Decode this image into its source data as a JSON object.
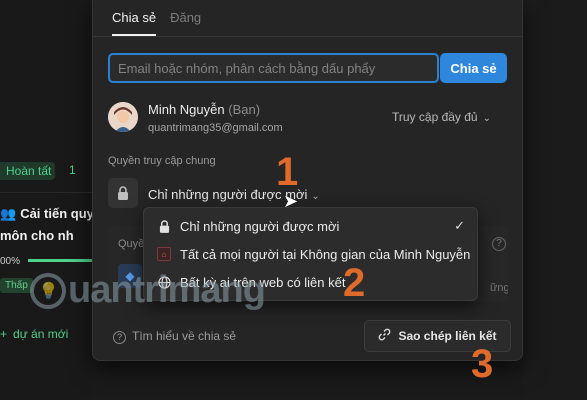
{
  "background": {
    "status_badge": "Hoàn tất",
    "status_count": "1",
    "task_title": "Cải tiến quy môn cho nh",
    "progress_label": "00%",
    "priority_badge": "Thấp",
    "new_project": "dự án mới"
  },
  "share_popup": {
    "tabs": [
      {
        "label": "Chia sẻ",
        "active": true
      },
      {
        "label": "Đăng",
        "active": false
      }
    ],
    "invite": {
      "placeholder": "Email hoặc nhóm, phân cách bằng dấu phẩy",
      "button_label": "Chia sẻ"
    },
    "user": {
      "name": "Minh Nguyễn",
      "you_label": "(Bạn)",
      "email": "quantrimang35@gmail.com",
      "access_level": "Truy cập đầy đủ"
    },
    "general_access": {
      "section_label": "Quyền truy cập chung",
      "current": "Chỉ những người được mời"
    },
    "hidden_section": {
      "label": "Quyề",
      "side_text": "ững có"
    },
    "footer": {
      "learn_more": "Tìm hiểu về chia sẻ",
      "copy_link": "Sao chép liên kết"
    }
  },
  "access_dropdown": {
    "options": [
      {
        "label": "Chỉ những người được mời",
        "icon": "lock-icon",
        "selected": true
      },
      {
        "label": "Tất cả mọi người tại Không gian của Minh Nguyễn",
        "icon": "workspace-icon",
        "selected": false
      },
      {
        "label": "Bất kỳ ai trên web có liên kết",
        "icon": "globe-icon",
        "selected": false
      }
    ]
  },
  "step_markers": [
    "1",
    "2",
    "3"
  ],
  "watermark": "uantrimang",
  "colors": {
    "accent": "#2f86dd",
    "step_marker": "#e06a2a",
    "status_green": "#4fd18b"
  }
}
